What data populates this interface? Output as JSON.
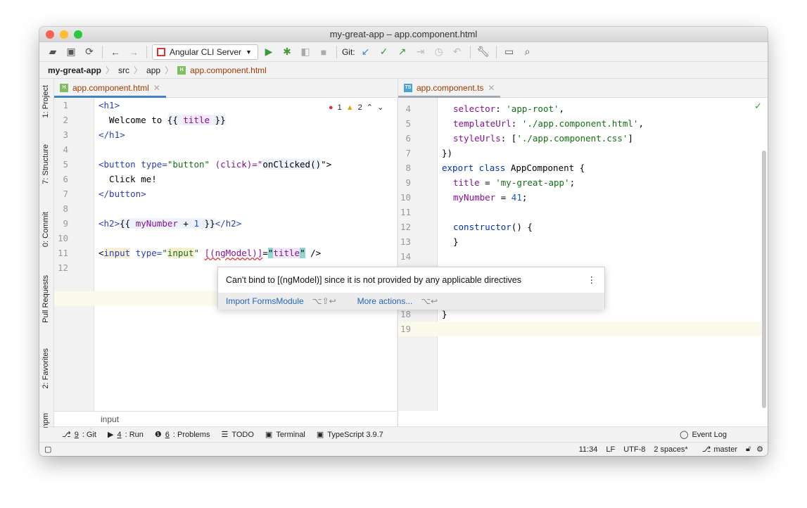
{
  "window": {
    "title": "my-great-app – app.component.html"
  },
  "toolbar": {
    "run_config": "Angular CLI Server",
    "git_label": "Git:"
  },
  "breadcrumb": [
    "my-great-app",
    "src",
    "app",
    "app.component.html"
  ],
  "left_tools": [
    "1: Project",
    "7: Structure",
    "0: Commit",
    "Pull Requests",
    "2: Favorites",
    "npm"
  ],
  "left_editor": {
    "tab": "app.component.html",
    "errors": "1",
    "warnings": "2",
    "footer": "input",
    "line_numbers": [
      "1",
      "2",
      "3",
      "4",
      "5",
      "6",
      "7",
      "8",
      "9",
      "10",
      "11",
      "12"
    ]
  },
  "right_editor": {
    "tab": "app.component.ts",
    "line_numbers": [
      "4",
      "5",
      "6",
      "7",
      "8",
      "9",
      "10",
      "11",
      "12",
      "13",
      "14",
      "18",
      "19"
    ]
  },
  "popup": {
    "message": "Can't bind to [(ngModel)] since it is not provided by any applicable directives",
    "action1": "Import FormsModule",
    "shortcut1": "⌥⇧↩",
    "action2": "More actions...",
    "shortcut2": "⌥↩"
  },
  "bottom_tools": [
    {
      "num": "9",
      "label": ": Git"
    },
    {
      "num": "4",
      "label": ": Run"
    },
    {
      "num": "6",
      "label": ": Problems"
    },
    {
      "num": "",
      "label": "TODO"
    },
    {
      "num": "",
      "label": "Terminal"
    },
    {
      "num": "",
      "label": "TypeScript 3.9.7"
    }
  ],
  "event_log": "Event Log",
  "status": {
    "position": "11:34",
    "line_sep": "LF",
    "encoding": "UTF-8",
    "indent": "2 spaces*",
    "branch": "master"
  },
  "code": {
    "h1_open": "<h1>",
    "l2a": "Welcome to ",
    "l2b": "{{ ",
    "l2c": "title",
    "l2d": " }}",
    "h1_close": "</h1>",
    "l5a": "<button ",
    "l5b": "type=",
    "l5c": "\"button\"",
    "l5d": " (click)=\"",
    "l5e": "onClicked()",
    "l5f": "\">",
    "l6": "Click me!",
    "l7": "</button>",
    "l9a": "<h2>",
    "l9b": "{{ ",
    "l9c": "myNumber",
    "l9d": " + ",
    "l9e": "1",
    "l9f": " }}",
    "l9g": "</h2>",
    "l11a": "<",
    "l11b": "input",
    "l11c": " type=",
    "l11d": "\"",
    "l11e": "input",
    "l11f": "\"",
    "l11g": " ",
    "l11h": "[(ngModel)]",
    "l11i": "=",
    "l11j": "\"",
    "l11k": "title",
    "l11l": "\"",
    "l11m": " />",
    "r4a": "selector",
    "r4b": ": ",
    "r4c": "'app-root'",
    "r4d": ",",
    "r5a": "templateUrl",
    "r5b": ": ",
    "r5c": "'./app.component.html'",
    "r5d": ",",
    "r6a": "styleUrls",
    "r6b": ": [",
    "r6c": "'./app.component.css'",
    "r6d": "]",
    "r7": "})",
    "r8a": "export class ",
    "r8b": "AppComponent {",
    "r9a": "title",
    "r9b": " = ",
    "r9c": "'my-great-app'",
    "r9d": ";",
    "r10a": "myNumber",
    "r10b": " = ",
    "r10c": "41",
    "r10d": ";",
    "r12a": "constructor",
    "r12b": "() {",
    "r13": "}",
    "r18": "}"
  }
}
